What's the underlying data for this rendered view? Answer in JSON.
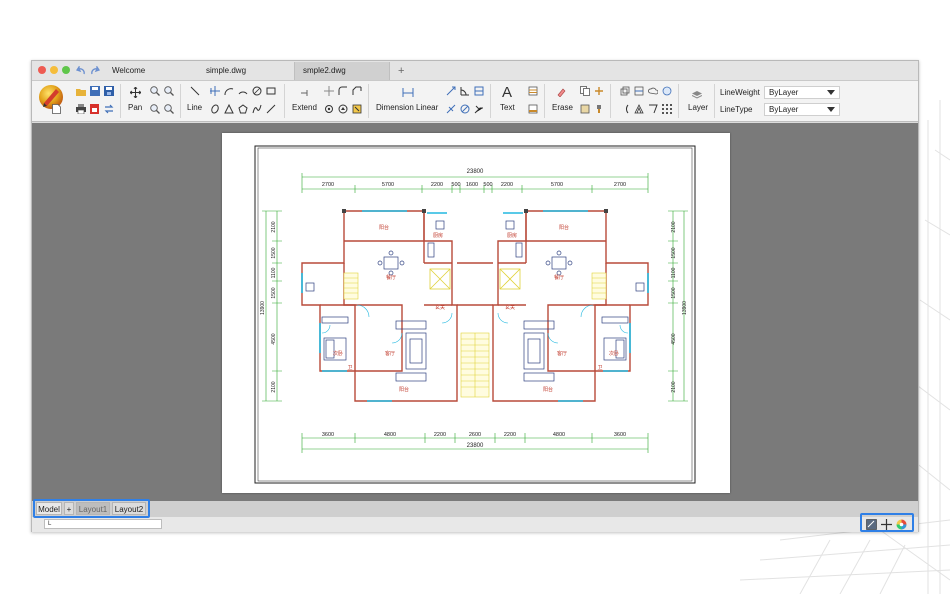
{
  "window": {
    "tabs": [
      {
        "label": "Welcome",
        "active": false
      },
      {
        "label": "simple.dwg",
        "active": false
      },
      {
        "label": "smple2.dwg",
        "active": true
      }
    ],
    "new_tab_symbol": "+"
  },
  "toolbar": {
    "pan": "Pan",
    "line": "Line",
    "extend": "Extend",
    "dimension": "Dimension Linear",
    "text": "Text",
    "erase": "Erase",
    "layer": "Layer",
    "lineweight_label": "LineWeight",
    "lineweight_value": "ByLayer",
    "linetype_label": "LineType",
    "linetype_value": "ByLayer"
  },
  "layout_tabs": {
    "model": "Model",
    "add": "+",
    "layout1": "Layout1",
    "layout2": "Layout2"
  },
  "command": {
    "value": "L"
  },
  "drawing": {
    "total_width": "23800",
    "top_dims": [
      "2700",
      "5700",
      "2200",
      "500",
      "1600",
      "500",
      "2200",
      "5700",
      "2700"
    ],
    "bottom_dims": [
      "3600",
      "4800",
      "2200",
      "2600",
      "2200",
      "4800",
      "3600"
    ],
    "left_dims": [
      "2100",
      "1500",
      "1100",
      "1500",
      "4500",
      "2100"
    ],
    "right_dims": [
      "2100",
      "1500",
      "1100",
      "1500",
      "4500",
      "2100"
    ],
    "side_total": "13900",
    "rooms": {
      "balcony_top_left": "阳台",
      "balcony_top_right": "阳台",
      "kitchen_left": "厨房",
      "kitchen_right": "厨房",
      "dining_left": "餐厅",
      "dining_right": "餐厅",
      "hall_left": "玄关",
      "hall_right": "玄关",
      "bedroom2_left": "次卧",
      "bedroom2_right": "次卧",
      "living_left": "客厅",
      "living_right": "客厅",
      "bath_left": "卫",
      "bath_right": "卫",
      "balcony_bottom_left": "阳台",
      "balcony_bottom_right": "阳台"
    }
  },
  "colors": {
    "accent_highlight": "#2f7fe6",
    "wall": "#b84a3a",
    "dimension": "#2ea82e",
    "window": "#22b8e0",
    "furniture": "#2e4080"
  }
}
